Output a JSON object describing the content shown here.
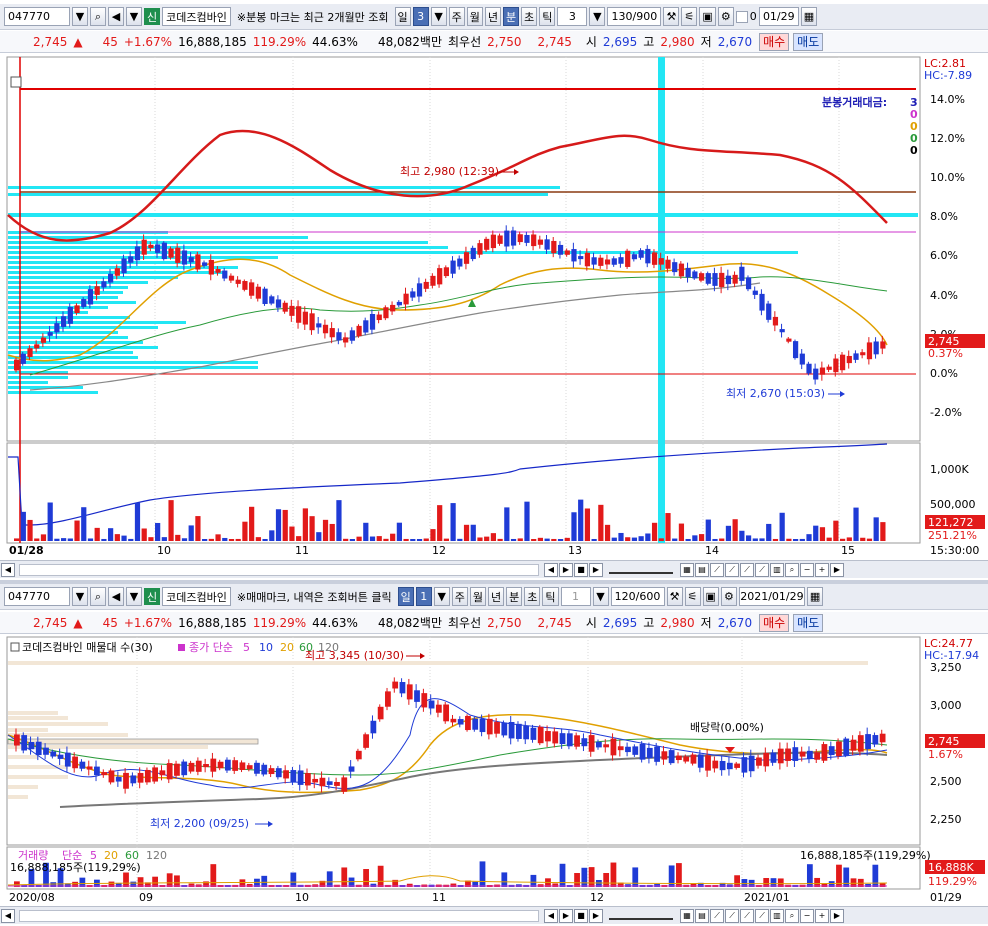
{
  "top": {
    "toolbar": {
      "code": "047770",
      "company": "코데즈컴바인",
      "company_tag": "신",
      "note": "※분봉 마크는 최근 2개월만 조회",
      "periods": [
        "일",
        "3",
        "주",
        "월",
        "년",
        "분",
        "초",
        "틱"
      ],
      "active_period": "분",
      "interval": "3",
      "count": "130/900",
      "date": "01/29",
      "zero_label": "0"
    },
    "quote": {
      "price": "2,745",
      "change": "45",
      "change_pct": "+1.67%",
      "volume": "16,888,185",
      "vol_ratio": "119.29%",
      "turnover": "44.63%",
      "amount": "48,082백만",
      "best_label": "최우선",
      "ask": "2,750",
      "bid": "2,745",
      "open_label": "시",
      "open": "2,695",
      "high_label": "고",
      "high": "2,980",
      "low_label": "저",
      "low": "2,670",
      "buy": "매수",
      "sell": "매도"
    },
    "axis": {
      "lc": "LC:2.81",
      "hc": "HC:-7.89",
      "pct_ticks": [
        "14.0%",
        "12.0%",
        "10.0%",
        "8.0%",
        "6.0%",
        "4.0%",
        "2.0%",
        "0.0%",
        "-2.0%"
      ],
      "price_tag": "2,745",
      "pct_tag": "0.37%",
      "vol_ticks": [
        "1,000K",
        "500,000"
      ],
      "vol_tag": "121,272",
      "vol_pct_tag": "251.21%",
      "time_label": "15:30:00"
    },
    "legend": {
      "title": "분봉거래대금:",
      "values": [
        "3",
        "0",
        "0",
        "0",
        "0"
      ]
    },
    "annotations": {
      "high": "최고 2,980 (12:39)",
      "low": "최저 2,670 (15:03)"
    },
    "x_labels": [
      "01/28",
      "10",
      "11",
      "12",
      "13",
      "14",
      "15"
    ]
  },
  "bottom": {
    "toolbar": {
      "code": "047770",
      "company": "코데즈컴바인",
      "company_tag": "신",
      "note": "※매매마크, 내역은 조회버튼 클릭",
      "periods": [
        "일",
        "1",
        "주",
        "월",
        "년",
        "분",
        "초",
        "틱"
      ],
      "active_period": "일",
      "interval": "1",
      "count": "120/600",
      "date": "2021/01/29"
    },
    "quote": {
      "price": "2,745",
      "change": "45",
      "change_pct": "+1.67%",
      "volume": "16,888,185",
      "vol_ratio": "119.29%",
      "turnover": "44.63%",
      "amount": "48,082백만",
      "best_label": "최우선",
      "ask": "2,750",
      "bid": "2,745",
      "open_label": "시",
      "open": "2,695",
      "high_label": "고",
      "high": "2,980",
      "low_label": "저",
      "low": "2,670",
      "buy": "매수",
      "sell": "매도"
    },
    "legend": {
      "title": "코데즈컴바인 매물대 수(30)",
      "ma_label": "종가 단순",
      "ma": [
        "5",
        "10",
        "20",
        "60",
        "120"
      ],
      "vol_label": "거래량",
      "vol_ma_label": "단순",
      "vol_ma": [
        "5",
        "20",
        "60",
        "120"
      ],
      "vol_value": "16,888,185주(119,29%)",
      "vol_value_right": "16,888,185주(119,29%)"
    },
    "axis": {
      "lc": "LC:24.77",
      "hc": "HC:-17.94",
      "price_ticks": [
        "3,250",
        "3,000",
        "2,750",
        "2,500",
        "2,250"
      ],
      "price_tag": "2,745",
      "pct_tag": "1.67%",
      "vol_tag": "16,888K",
      "vol_pct_tag": "119.29%"
    },
    "annotations": {
      "high": "최고 3,345 (10/30)",
      "low": "최저 2,200 (09/25)",
      "dividend": "배당락(0,00%)"
    },
    "x_labels": [
      "2020/08",
      "09",
      "10",
      "11",
      "12",
      "2021/01",
      "01/29"
    ]
  },
  "colors": {
    "up": "#e21a1a",
    "down": "#1f3bd6",
    "cyan": "#22e6f4"
  }
}
